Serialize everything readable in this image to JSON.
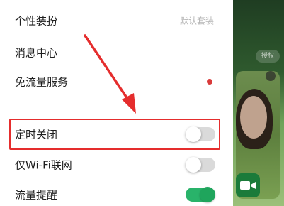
{
  "settings": {
    "items": [
      {
        "label": "个性装扮",
        "value": "默认套装"
      },
      {
        "label": "消息中心"
      },
      {
        "label": "免流量服务"
      },
      {
        "label": "定时关闭",
        "toggle": false
      },
      {
        "label": "仅Wi-Fi联网",
        "toggle": false
      },
      {
        "label": "流量提醒",
        "toggle": true
      }
    ]
  },
  "background_app": {
    "pill_text": "授权"
  },
  "colors": {
    "highlight": "#e52d2d",
    "badge_dot": "#d93a3a",
    "toggle_on": "#29b36a",
    "toggle_off": "#dadada"
  }
}
